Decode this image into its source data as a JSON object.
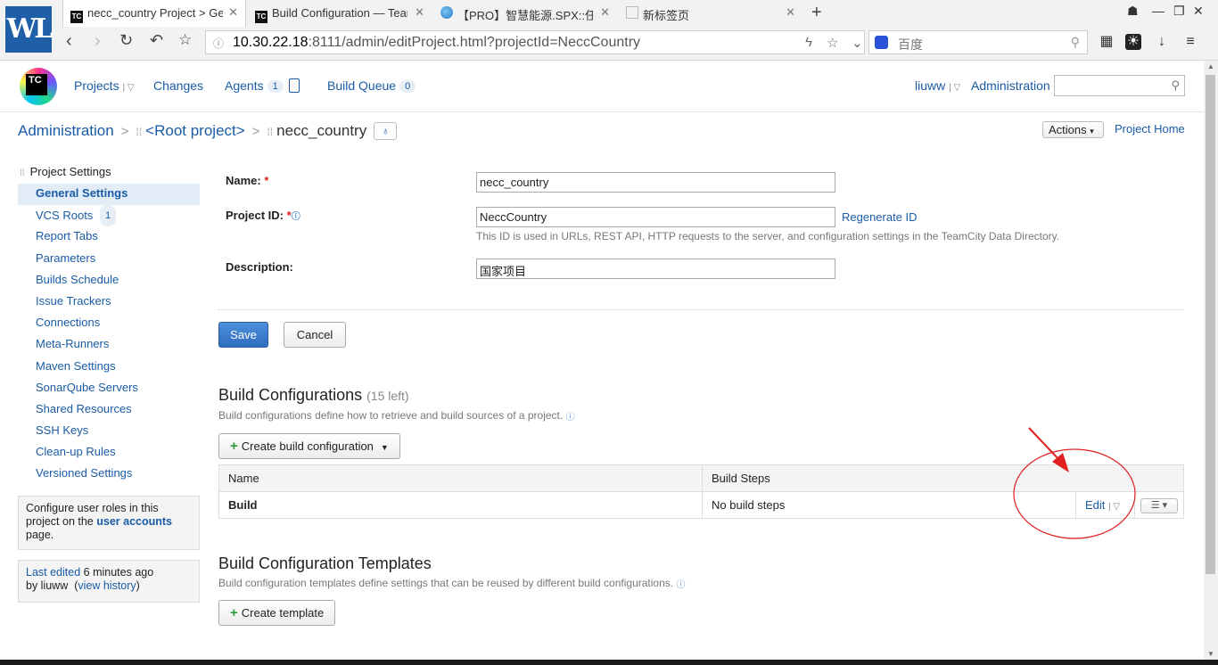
{
  "browser": {
    "logo_text": "WL",
    "tabs": [
      {
        "title": "necc_country Project > General Settings",
        "favicon": "TC",
        "active": true
      },
      {
        "title": "Build Configuration — TeamCity",
        "favicon": "TC",
        "active": false
      },
      {
        "title": "【PRO】智慧能源.SPX::任务",
        "favicon": "globe",
        "active": false
      },
      {
        "title": "新标签页",
        "favicon": "blank",
        "active": false
      }
    ],
    "url_host": "10.30.22.18",
    "url_rest": ":8111/admin/editProject.html?projectId=NeccCountry",
    "search_placeholder": "百度"
  },
  "header": {
    "logo_text": "TC",
    "nav": {
      "projects": "Projects",
      "changes": "Changes",
      "agents": "Agents",
      "agents_count": "1",
      "build_queue": "Build Queue",
      "build_queue_count": "0"
    },
    "user": "liuww",
    "administration": "Administration"
  },
  "breadcrumb": {
    "administration": "Administration",
    "root": "<Root project>",
    "current": "necc_country",
    "actions": "Actions",
    "project_home": "Project Home"
  },
  "sidebar": {
    "heading": "Project Settings",
    "items": [
      {
        "label": "General Settings",
        "active": true
      },
      {
        "label": "VCS Roots",
        "count": "1"
      },
      {
        "label": "Report Tabs"
      },
      {
        "label": "Parameters"
      },
      {
        "label": "Builds Schedule"
      },
      {
        "label": "Issue Trackers"
      },
      {
        "label": "Connections"
      },
      {
        "label": "Meta-Runners"
      },
      {
        "label": "Maven Settings"
      },
      {
        "label": "SonarQube Servers"
      },
      {
        "label": "Shared Resources"
      },
      {
        "label": "SSH Keys"
      },
      {
        "label": "Clean-up Rules"
      },
      {
        "label": "Versioned Settings"
      }
    ],
    "roles_box": {
      "pre": "Configure user roles in this project on the",
      "link": "user accounts",
      "post": "page."
    },
    "edit_box": {
      "last_edited": "Last edited",
      "time": "6 minutes ago",
      "by": "by liuww",
      "view_history": "view history"
    }
  },
  "form": {
    "name_label": "Name:",
    "name_value": "necc_country",
    "id_label": "Project ID:",
    "id_value": "NeccCountry",
    "regenerate": "Regenerate ID",
    "id_hint": "This ID is used in URLs, REST API, HTTP requests to the server, and configuration settings in the TeamCity Data Directory.",
    "desc_label": "Description:",
    "desc_value": "国家项目",
    "save": "Save",
    "cancel": "Cancel"
  },
  "build_configs": {
    "title": "Build Configurations",
    "left": "(15 left)",
    "desc": "Build configurations define how to retrieve and build sources of a project.",
    "create": "Create build configuration",
    "col_name": "Name",
    "col_steps": "Build Steps",
    "rows": [
      {
        "name": "Build",
        "steps": "No build steps",
        "edit": "Edit"
      }
    ]
  },
  "templates": {
    "title": "Build Configuration Templates",
    "desc": "Build configuration templates define settings that can be reused by different build configurations.",
    "create": "Create template"
  },
  "colors": {
    "link": "#1a5ba6",
    "save_button": "#2f6dbf",
    "annotation": "#e02020"
  }
}
